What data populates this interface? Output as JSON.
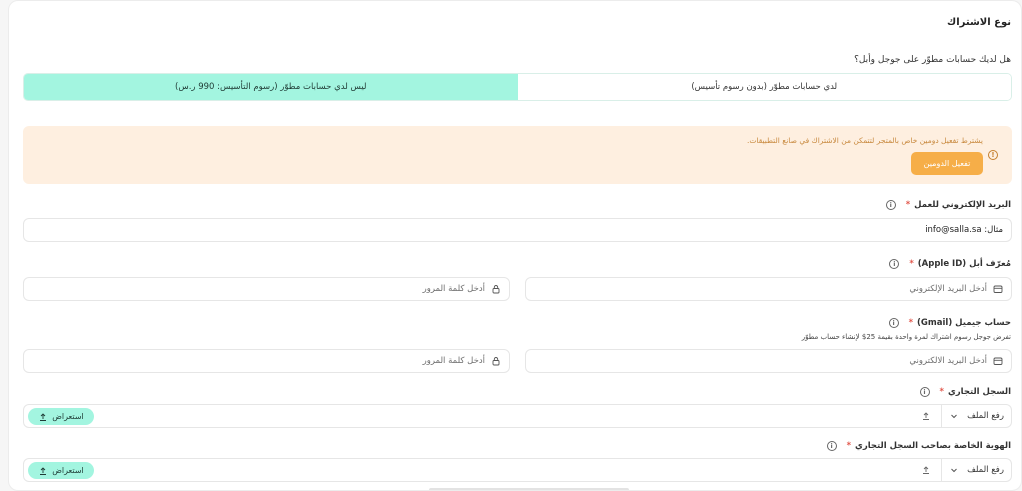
{
  "section": {
    "title": "نوع الاشتراك"
  },
  "developer_account": {
    "question": "هل لديك حسابات مطوّر على جوجل وأبل؟",
    "options": [
      {
        "label": "لدي حسابات مطوّر (بدون رسوم تأسيس)",
        "selected": false
      },
      {
        "label": "ليس لدي حسابات مطوّر (رسوم التأسيس: 990 ر.س)",
        "selected": true
      }
    ]
  },
  "alert": {
    "text": "يشترط تفعيل دومين خاص بالمتجر لتتمكن من الاشتراك في صانع التطبيقات.",
    "button_label": "تفعيل الدومين",
    "color": "#f6ae48"
  },
  "work_email": {
    "label": "البريد الإلكتروني للعمل",
    "required_mark": "*",
    "value": "مثال: info@salla.sa"
  },
  "apple_id": {
    "label": "مُعرّف أبل (Apple ID)",
    "required_mark": "*",
    "email_placeholder": "أدخل البريد الإلكتروني",
    "password_placeholder": "أدخل كلمة المرور"
  },
  "gmail": {
    "label": "حساب جيميل (Gmail)",
    "required_mark": "*",
    "hint": "تفرض جوجل رسوم اشتراك لمرة واحدة بقيمة 25$ لإنشاء حساب مطوّر",
    "email_placeholder": "أدخل البريد الالكتروني",
    "password_placeholder": "أدخل كلمة المرور"
  },
  "commercial_register": {
    "label": "السجل التجاري",
    "required_mark": "*",
    "upload_label": "رفع الملف",
    "browse_label": "استعراض"
  },
  "owner_id": {
    "label": "الهوية الخاصة بصاحب السجل التجاري",
    "required_mark": "*",
    "upload_label": "رفع الملف",
    "browse_label": "استعراض"
  },
  "colors": {
    "accent": "#a3f5e0",
    "warning_bg": "#feefe0",
    "warning_text": "#c8893e"
  }
}
